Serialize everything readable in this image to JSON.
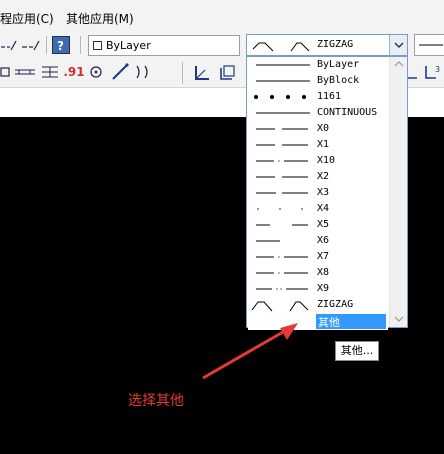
{
  "menu": {
    "items": [
      {
        "label": "程应用(C)"
      },
      {
        "label": "其他应用(M)"
      }
    ]
  },
  "toolbar": {
    "layer_combo": {
      "value": "ByLayer"
    },
    "linetype_combo": {
      "value": "ZIGZAG"
    },
    "precision_label": ".91"
  },
  "linetype_dropdown": {
    "options": [
      {
        "label": "ByLayer",
        "style": "solid"
      },
      {
        "label": "ByBlock",
        "style": "solid"
      },
      {
        "label": "1161",
        "style": "dots"
      },
      {
        "label": "CONTINUOUS",
        "style": "solid"
      },
      {
        "label": "X0",
        "style": "dash"
      },
      {
        "label": "X1",
        "style": "dash"
      },
      {
        "label": "X10",
        "style": "dashdot"
      },
      {
        "label": "X2",
        "style": "dash"
      },
      {
        "label": "X3",
        "style": "longdash"
      },
      {
        "label": "X4",
        "style": "sparsedots"
      },
      {
        "label": "X5",
        "style": "longgap"
      },
      {
        "label": "X6",
        "style": "short"
      },
      {
        "label": "X7",
        "style": "dashdot"
      },
      {
        "label": "X8",
        "style": "dashdot"
      },
      {
        "label": "X9",
        "style": "dashdotdot"
      },
      {
        "label": "ZIGZAG",
        "style": "zigzag"
      },
      {
        "label": "其他",
        "style": "none",
        "selected": true
      }
    ]
  },
  "tooltip": {
    "text": "其他..."
  },
  "annotation": {
    "text": "选择其他",
    "color": "#e53935"
  },
  "colors": {
    "selection": "#3399ff",
    "canvas": "#000000",
    "arrow": "#e53935"
  }
}
